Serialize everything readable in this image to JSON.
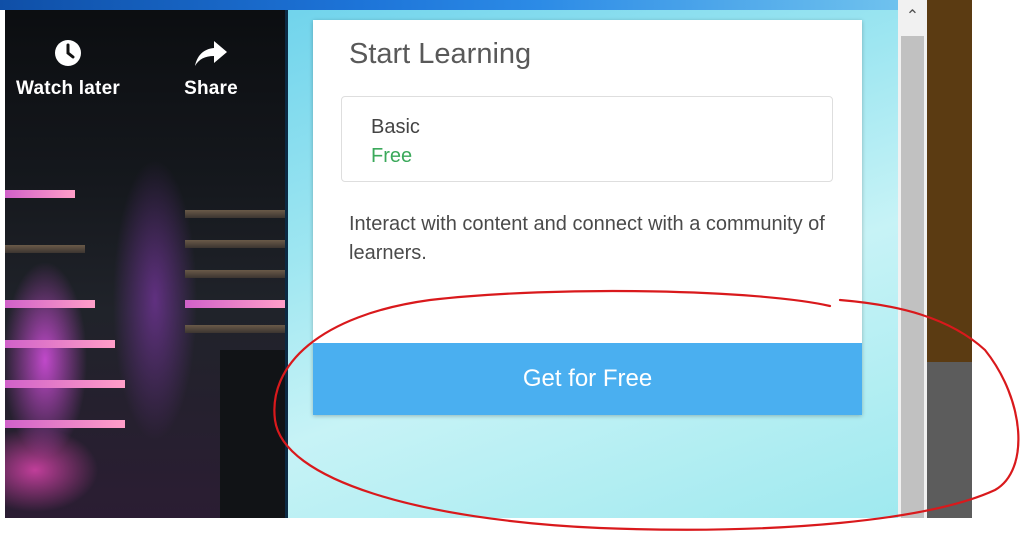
{
  "video": {
    "watch_later_label": "Watch later",
    "share_label": "Share",
    "watch_later_icon": "clock-icon",
    "share_icon": "share-arrow-icon"
  },
  "card": {
    "title": "Start Learning",
    "plan": {
      "name": "Basic",
      "price": "Free"
    },
    "description": "Interact with content and connect with a community of learners.",
    "cta_label": "Get for Free"
  },
  "colors": {
    "cta_background": "#4aaff0",
    "price_green": "#3ba95b",
    "annotation_red": "#d9191c"
  }
}
